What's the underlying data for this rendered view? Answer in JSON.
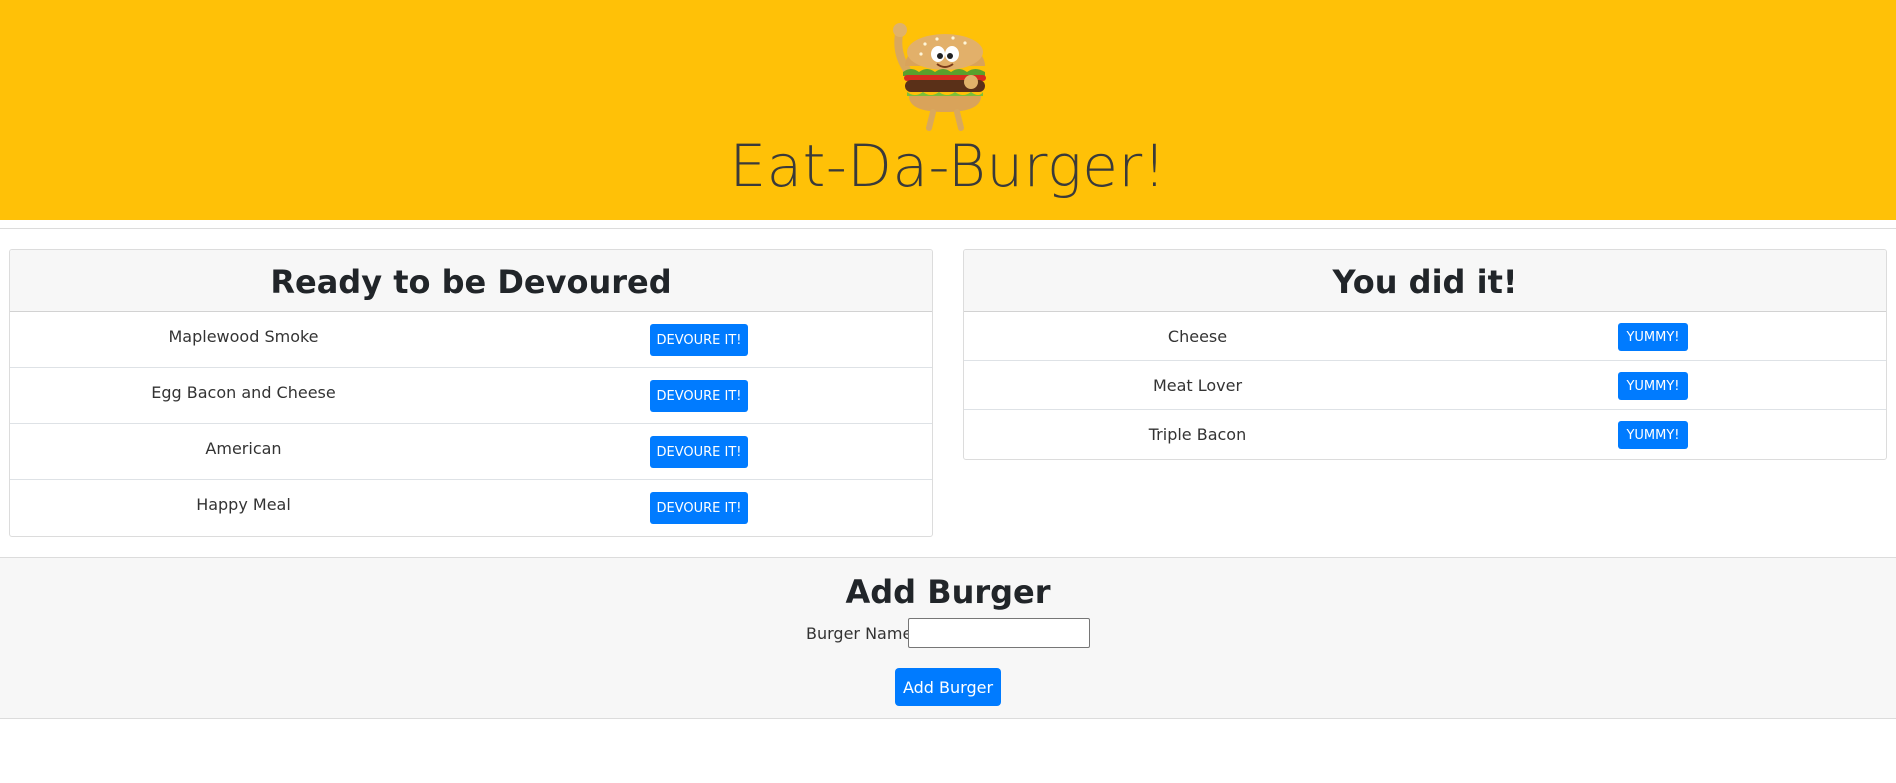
{
  "header": {
    "title": "Eat-Da-Burger!",
    "logo_icon": "burger-mascot-icon",
    "background_color": "#ffc107"
  },
  "ready_card": {
    "title": "Ready to be Devoured",
    "items": [
      {
        "name": "Maplewood Smoke",
        "button": "DEVOURE IT!"
      },
      {
        "name": "Egg Bacon and Cheese",
        "button": "DEVOURE IT!"
      },
      {
        "name": "American",
        "button": "DEVOURE IT!"
      },
      {
        "name": "Happy Meal",
        "button": "DEVOURE IT!"
      }
    ]
  },
  "devoured_card": {
    "title": "You did it!",
    "items": [
      {
        "name": "Cheese",
        "button": "YUMMY!"
      },
      {
        "name": "Meat Lover",
        "button": "YUMMY!"
      },
      {
        "name": "Triple Bacon",
        "button": "YUMMY!"
      }
    ]
  },
  "add_form": {
    "title": "Add Burger",
    "label": "Burger Name:",
    "input_value": "",
    "submit_label": "Add Burger"
  },
  "colors": {
    "button_primary": "#007bff",
    "card_header_bg": "#f7f7f7"
  }
}
